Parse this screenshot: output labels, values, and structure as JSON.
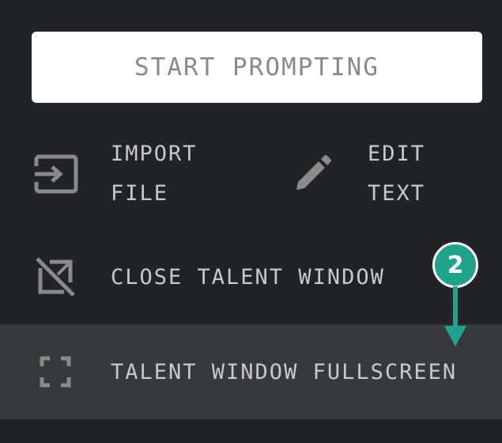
{
  "start_button": {
    "label": "START PROMPTING"
  },
  "menu": {
    "import_file": {
      "line1": "IMPORT",
      "line2": "FILE",
      "icon": "import-icon"
    },
    "edit_text": {
      "line1": "EDIT",
      "line2": "TEXT",
      "icon": "pencil-icon"
    },
    "close_talent_window": {
      "label": "CLOSE TALENT WINDOW",
      "icon": "close-window-icon"
    },
    "talent_window_fullscreen": {
      "label": "TALENT WINDOW FULLSCREEN",
      "icon": "fullscreen-icon"
    }
  },
  "callout": {
    "number": "2",
    "color": "#1fa38b"
  },
  "colors": {
    "background": "#222326",
    "highlight_row": "#38393b",
    "text": "#c9c9c9",
    "icon": "#8a8a8a"
  }
}
